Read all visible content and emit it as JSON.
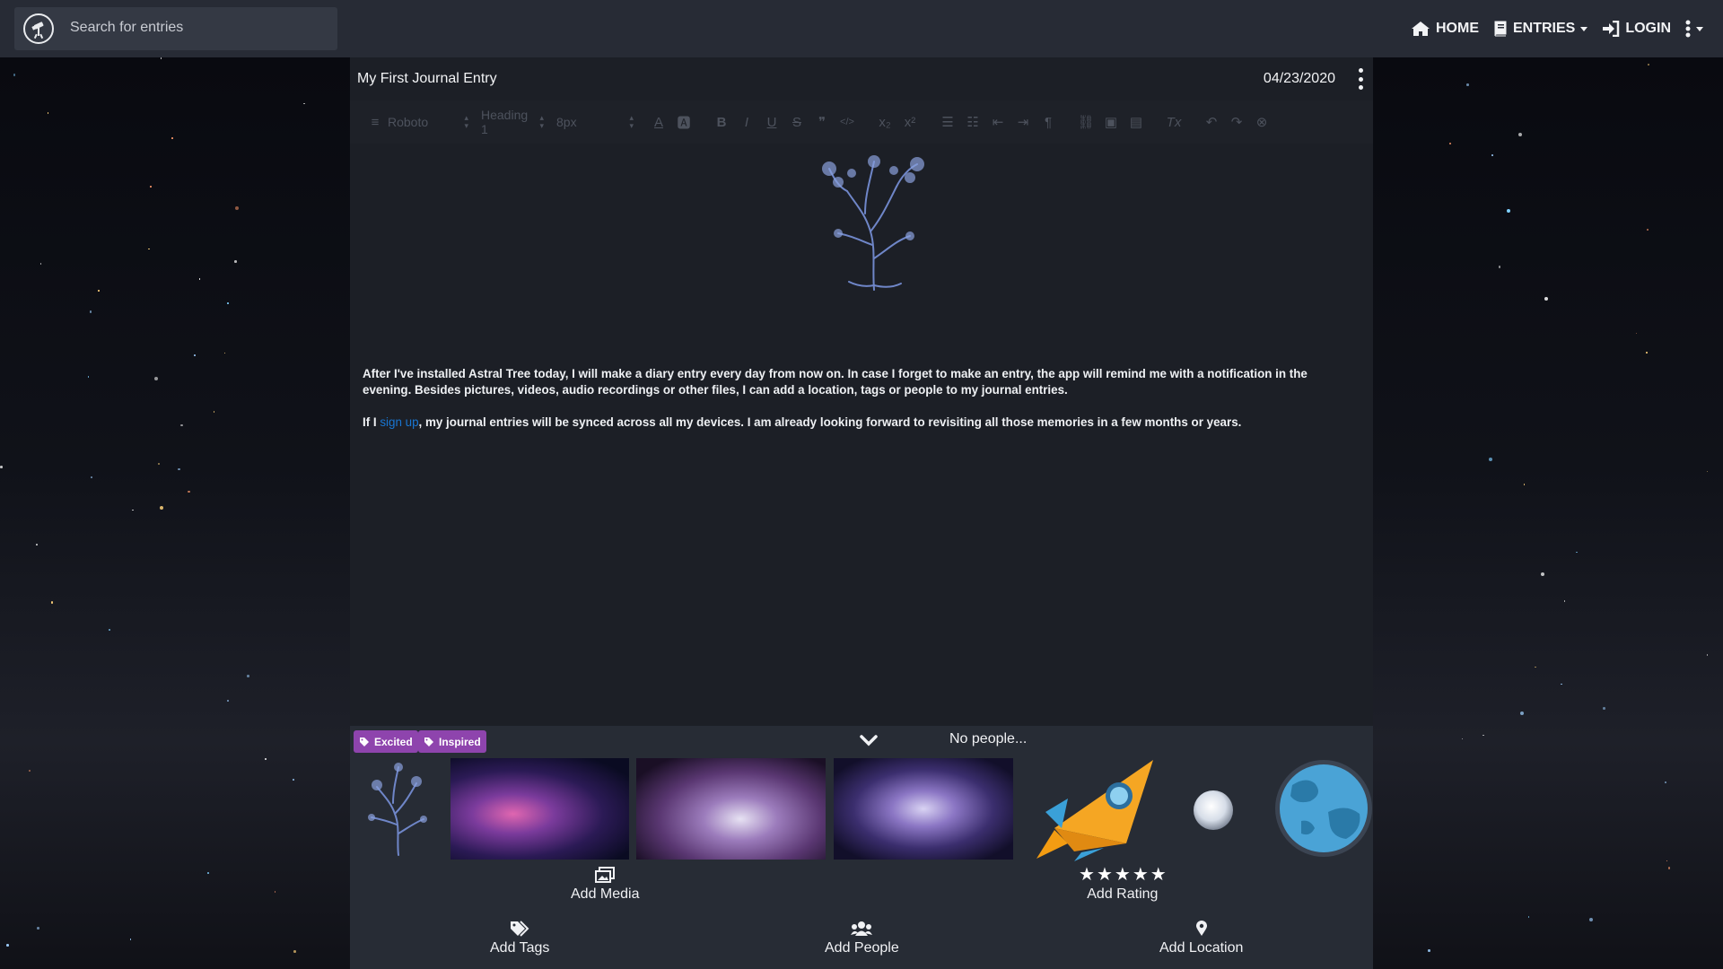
{
  "topbar": {
    "search_placeholder": "Search for entries",
    "nav": {
      "home": "HOME",
      "entries": "ENTRIES",
      "login": "LOGIN"
    }
  },
  "entry": {
    "title": "My First Journal Entry",
    "date": "04/23/2020"
  },
  "toolbar": {
    "font": "Roboto",
    "heading": "Heading 1",
    "size": "8px"
  },
  "content": {
    "paragraph1": "After I've installed Astral Tree today, I will make a diary entry every day from now on. In case I forget to make an entry, the app will remind me with a notification in the evening. Besides pictures, videos, audio recordings or other files, I can add a location, tags or people to my journal entries.",
    "paragraph2_before": "If I ",
    "paragraph2_link": "sign up",
    "paragraph2_after": ", my journal entries will be synced across all my devices. I am already looking forward to revisiting all those memories in a few months or years."
  },
  "bottom": {
    "tags": [
      "Excited",
      "Inspired"
    ],
    "no_people": "No people...",
    "add_media": "Add Media",
    "add_rating": "Add Rating",
    "rating": 5,
    "rating_max": 5,
    "add_tags": "Add Tags",
    "add_people": "Add People",
    "add_location": "Add Location"
  },
  "colors": {
    "topbar_bg": "#272b35",
    "tag_purple": "#8e44ad",
    "link_blue": "#1976d2"
  }
}
